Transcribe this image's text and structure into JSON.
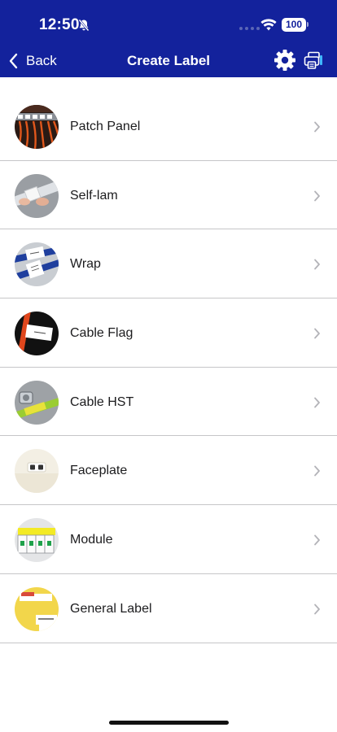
{
  "status_bar": {
    "time": "12:50",
    "battery": "100",
    "icons": [
      "bell-slash-icon",
      "cellular-dots-icon",
      "wifi-icon",
      "battery-icon"
    ]
  },
  "nav": {
    "back_label": "Back",
    "title": "Create Label",
    "icons": [
      "chevron-left-icon",
      "gear-icon",
      "printer-icon"
    ]
  },
  "colors": {
    "header_bg": "#13229c",
    "separator": "#c6c6c8",
    "chevron": "#b3b3b8"
  },
  "items": [
    {
      "label": "Patch Panel",
      "icon": "patch-panel-thumbnail"
    },
    {
      "label": "Self-lam",
      "icon": "self-lam-thumbnail"
    },
    {
      "label": "Wrap",
      "icon": "wrap-thumbnail"
    },
    {
      "label": "Cable Flag",
      "icon": "cable-flag-thumbnail"
    },
    {
      "label": "Cable HST",
      "icon": "cable-hst-thumbnail"
    },
    {
      "label": "Faceplate",
      "icon": "faceplate-thumbnail"
    },
    {
      "label": "Module",
      "icon": "module-thumbnail"
    },
    {
      "label": "General Label",
      "icon": "general-label-thumbnail"
    }
  ]
}
